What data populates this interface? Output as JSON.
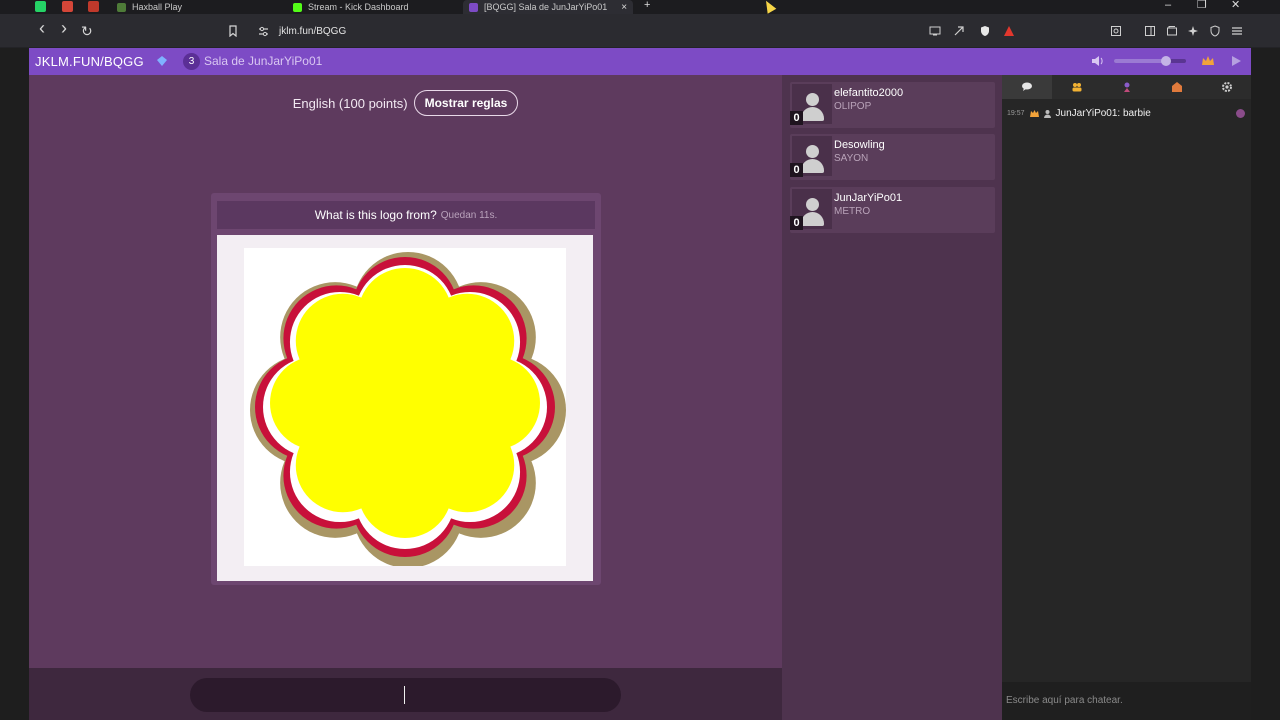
{
  "browser": {
    "tabs": [
      {
        "label": "Haxball Play",
        "icon_color": "#4e7b38"
      },
      {
        "label": "Stream - Kick Dashboard",
        "icon_color": "#53fc18"
      },
      {
        "label": "[BQGG] Sala de JunJarYiPo01",
        "icon_color": "#7d4bc5"
      }
    ],
    "close_glyph": "×",
    "new_tab_glyph": "+",
    "window_controls": {
      "minimize": "–",
      "restore": "❐",
      "close": "✕"
    },
    "url": "jklm.fun/BQGG",
    "nav": {
      "back": "‹",
      "forward": "›",
      "reload": "↻"
    }
  },
  "app": {
    "domain": "JKLM.FUN/BQGG",
    "player_count": "3",
    "room_name": "Sala de JunJarYiPo01",
    "volume_level": 0.72
  },
  "game": {
    "rules_text": "English (100 points)",
    "rules_button": "Mostrar reglas",
    "question": "What is this logo from?",
    "time_left": "Quedan 11s.",
    "logo_colors": {
      "outer": "#a99664",
      "ring": "#c8103a",
      "gap": "#ffffff",
      "fill": "#ffff00"
    }
  },
  "players": [
    {
      "name": "elefantito2000",
      "tag": "OLIPOP",
      "score": "0"
    },
    {
      "name": "Desowling",
      "tag": "SAYON",
      "score": "0"
    },
    {
      "name": "JunJarYiPo01",
      "tag": "METRO",
      "score": "0"
    }
  ],
  "chat": {
    "tabs": [
      "chat-icon",
      "people-icon",
      "trophy-icon",
      "shop-icon",
      "settings-icon"
    ],
    "messages": [
      {
        "time": "19:57",
        "author": "JunJarYiPo01",
        "text": "barbie"
      }
    ],
    "placeholder": "Escribe aquí para chatear."
  }
}
